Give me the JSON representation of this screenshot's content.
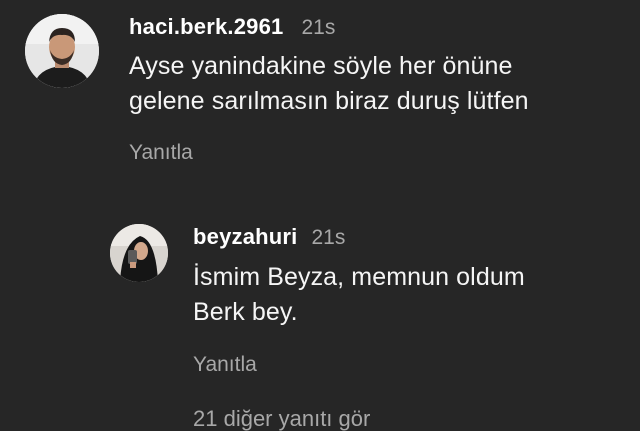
{
  "comments": [
    {
      "username": "haci.berk.2961",
      "time": "21s",
      "text_line1": "Ayse yanindakine söyle her önüne",
      "text_line2": "gelene sarılmasın biraz duruş lütfen",
      "reply_label": "Yanıtla"
    }
  ],
  "replies": [
    {
      "username": "beyzahuri",
      "time": "21s",
      "text_line1": "İsmim Beyza, memnun oldum",
      "text_line2": "Berk bey.",
      "reply_label": "Yanıtla"
    }
  ],
  "more_replies_label": "21 diğer yanıtı gör",
  "colors": {
    "background": "#262626",
    "primary_text": "#f5f5f5",
    "secondary_text": "#a8a8a8"
  }
}
